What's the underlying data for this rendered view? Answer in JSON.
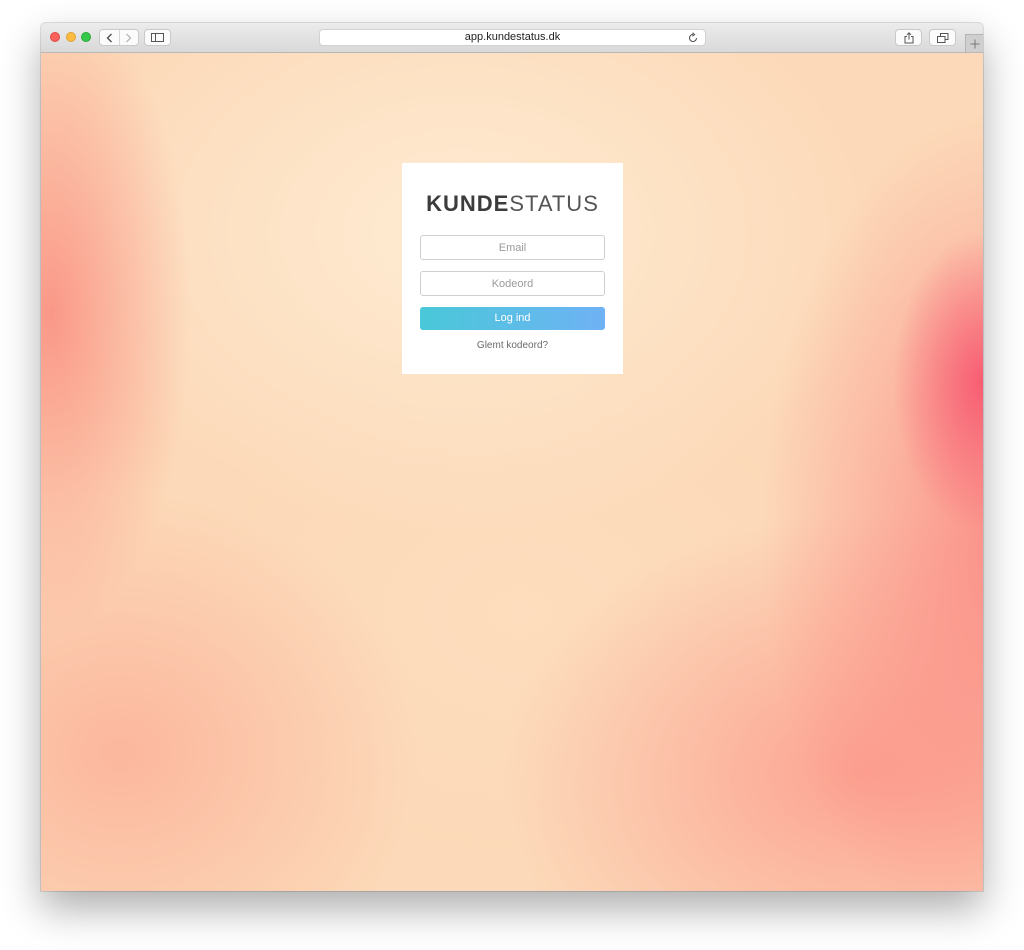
{
  "browser": {
    "url": "app.kundestatus.dk",
    "icons": {
      "back": "chevron-left-icon",
      "forward": "chevron-right-icon",
      "sidebar": "sidebar-icon",
      "reload": "reload-icon",
      "share": "share-icon",
      "tabs": "tabs-overview-icon",
      "new_tab": "plus-icon"
    }
  },
  "login": {
    "logo_bold": "KUNDE",
    "logo_light": "STATUS",
    "email_placeholder": "Email",
    "password_placeholder": "Kodeord",
    "submit_label": "Log ind",
    "forgot_label": "Glemt kodeord?"
  },
  "colors": {
    "button_gradient_start": "#49c8d8",
    "button_gradient_end": "#6fb2f5",
    "logo_text": "#3c3c3c"
  }
}
